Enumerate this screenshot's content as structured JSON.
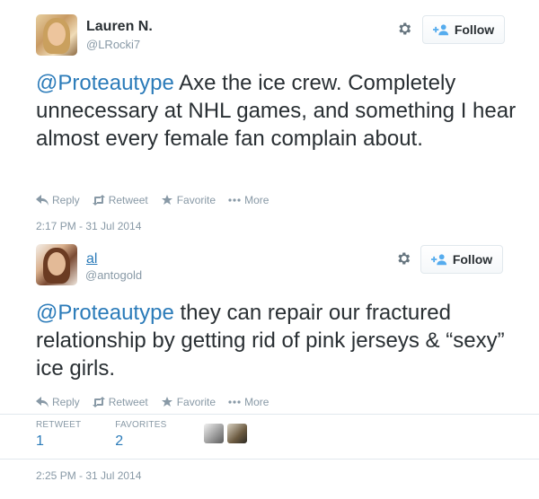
{
  "tweets": [
    {
      "name": "Lauren N.",
      "handle": "@LRocki7",
      "follow_label": "Follow",
      "mention": "@Proteautype",
      "text": " Axe the ice crew. Completely unnecessary at NHL games, and something I hear almost every female fan complain about.",
      "actions": {
        "reply": "Reply",
        "retweet": "Retweet",
        "favorite": "Favorite",
        "more": "More"
      },
      "timestamp": "2:17 PM - 31 Jul 2014"
    },
    {
      "name": "al",
      "handle": "@antogold",
      "follow_label": "Follow",
      "mention": "@Proteautype",
      "text": " they can repair our fractured relationship by getting rid of pink jerseys & “sexy” ice girls.",
      "actions": {
        "reply": "Reply",
        "retweet": "Retweet",
        "favorite": "Favorite",
        "more": "More"
      },
      "stats": {
        "retweets_label": "RETWEET",
        "retweets": "1",
        "favorites_label": "FAVORITES",
        "favorites": "2"
      },
      "timestamp": "2:25 PM - 31 Jul 2014"
    }
  ],
  "icons": [
    "gear-icon",
    "add-user-icon",
    "reply-icon",
    "retweet-icon",
    "star-icon",
    "more-icon"
  ],
  "colors": {
    "link": "#2b7bb9",
    "muted": "#8899a6",
    "text": "#292f33",
    "border": "#e1e8ed"
  }
}
